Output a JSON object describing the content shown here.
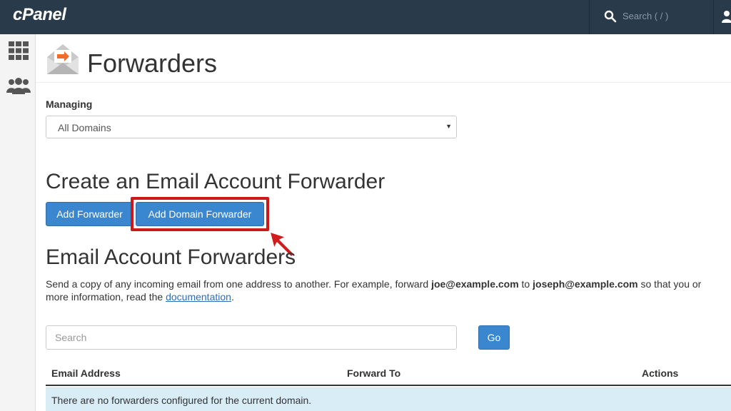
{
  "topbar": {
    "logo": "cPanel",
    "search_placeholder": "Search ( / )"
  },
  "page": {
    "title": "Forwarders",
    "managing_label": "Managing",
    "domain_select": {
      "selected": "All Domains"
    }
  },
  "create_section": {
    "heading": "Create an Email Account Forwarder",
    "add_forwarder_label": "Add Forwarder",
    "add_domain_forwarder_label": "Add Domain Forwarder"
  },
  "list_section": {
    "heading": "Email Account Forwarders",
    "description": {
      "part1": "Send a copy of any incoming email from one address to another. For example, forward ",
      "example_from": "joe@example.com",
      "part2": " to ",
      "example_to": "joseph@example.com",
      "part3": " so that you or",
      "line2_start": "more information, read the ",
      "link": "documentation",
      "line2_end": "."
    },
    "search_placeholder": "Search",
    "go_label": "Go",
    "table": {
      "headers": [
        "Email Address",
        "Forward To",
        "Actions"
      ],
      "empty_message": "There are no forwarders configured for the current domain."
    }
  },
  "colors": {
    "topbar": "#293a4a",
    "primary_button": "#3a87d0",
    "highlight": "#cc1818",
    "info_row": "#d9edf7"
  }
}
